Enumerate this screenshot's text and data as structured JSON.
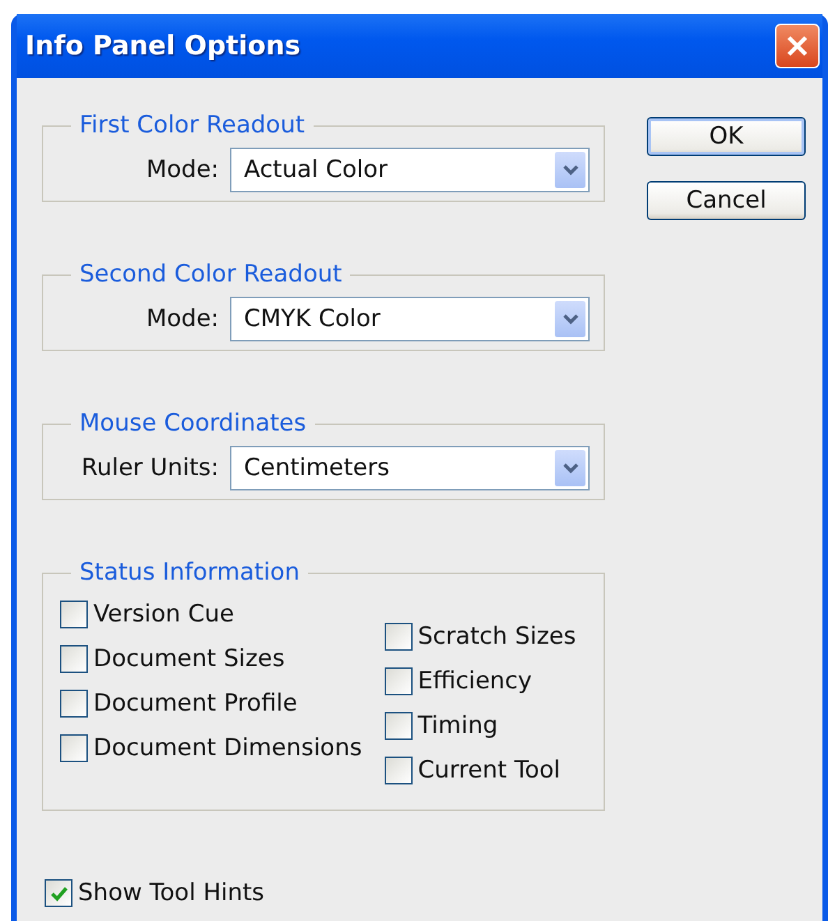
{
  "window": {
    "title": "Info Panel Options"
  },
  "groups": [
    {
      "title": "First Color Readout",
      "field": {
        "label": "Mode:",
        "value": "Actual Color"
      }
    },
    {
      "title": "Second Color Readout",
      "field": {
        "label": "Mode:",
        "value": "CMYK Color"
      }
    },
    {
      "title": "Mouse Coordinates",
      "field": {
        "label": "Ruler Units:",
        "value": "Centimeters"
      }
    }
  ],
  "status_information": {
    "title": "Status Information",
    "columns": [
      {
        "items": [
          {
            "label": "Version Cue",
            "checked": false
          },
          {
            "label": "Document Sizes",
            "checked": false
          },
          {
            "label": "Document Profile",
            "checked": false
          },
          {
            "label": "Document Dimensions",
            "checked": false
          }
        ]
      },
      {
        "items": [
          {
            "label": "Scratch Sizes",
            "checked": false
          },
          {
            "label": "Efficiency",
            "checked": false
          },
          {
            "label": "Timing",
            "checked": false
          },
          {
            "label": "Current Tool",
            "checked": false
          }
        ]
      }
    ]
  },
  "show_tool_hints": {
    "label": "Show Tool Hints",
    "checked": true
  },
  "buttons": [
    {
      "label": "OK",
      "default": true
    },
    {
      "label": "Cancel",
      "default": false
    }
  ]
}
